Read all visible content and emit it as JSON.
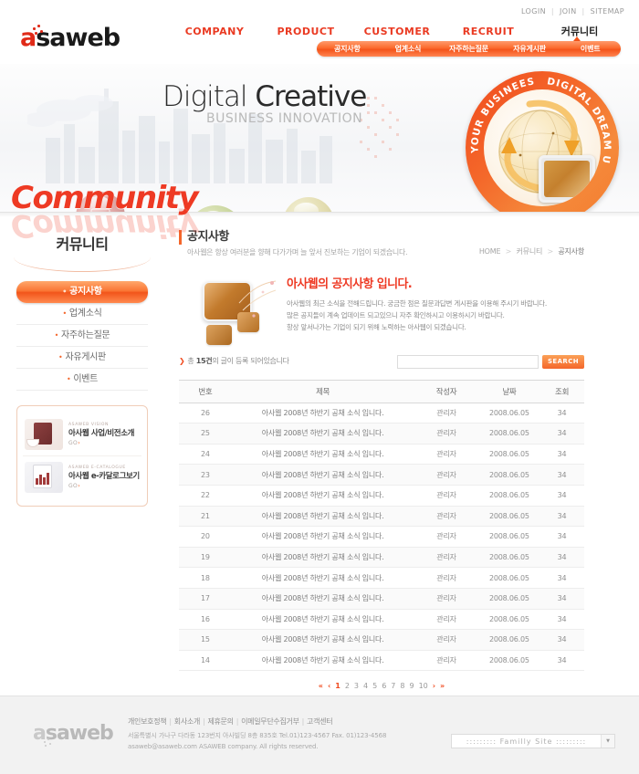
{
  "brand": {
    "logo_a": "a",
    "logo_rest": "saweb",
    "footer_logo_a": "a",
    "footer_logo_rest": "saweb"
  },
  "utility": {
    "login": "LOGIN",
    "join": "JOIN",
    "sitemap": "SITEMAP",
    "sep": "|"
  },
  "mainnav": [
    {
      "label": "COMPANY",
      "kr": false
    },
    {
      "label": "PRODUCT",
      "kr": false
    },
    {
      "label": "CUSTOMER",
      "kr": false
    },
    {
      "label": "RECRUIT",
      "kr": false
    },
    {
      "label": "커뮤니티",
      "kr": true
    }
  ],
  "subnav": [
    {
      "label": "공지사항"
    },
    {
      "label": "업계소식"
    },
    {
      "label": "자주하는질문"
    },
    {
      "label": "자유게시판"
    },
    {
      "label": "이벤트"
    }
  ],
  "hero": {
    "title_1": "Digital",
    "title_2": "Creative",
    "subtitle": "BUSINESS INNOVATION",
    "badge_left": "YOUR BUSINEES PARTNER",
    "badge_right": "DIGITAL DREAM UTOPIA",
    "orb_1_icon": "play-icon",
    "orb_2_icon": "email-icon",
    "orb_3_icon": "click-gear-icon"
  },
  "section": {
    "art_title": "Community",
    "kr_title": "커뮤니티"
  },
  "sidenav": [
    {
      "label": "공지사항",
      "active": true
    },
    {
      "label": "업계소식",
      "active": false
    },
    {
      "label": "자주하는질문",
      "active": false
    },
    {
      "label": "자유게시판",
      "active": false
    },
    {
      "label": "이벤트",
      "active": false
    }
  ],
  "side_banners": [
    {
      "eyebrow": "ASAWEB VISION",
      "title": "아사웹 사업/비전소개",
      "go": "GO"
    },
    {
      "eyebrow": "ASAWEB E-CATALOGUE",
      "title": "아사웹 e-카달로그보기",
      "go": "GO"
    }
  ],
  "page": {
    "title": "공지사항",
    "desc": "아사웹은 항상 여러분을 향해 다가가며 늘 앞서 진보하는 기업이 되겠습니다.",
    "breadcrumb": [
      "HOME",
      "커뮤니티",
      "공지사항"
    ],
    "breadcrumb_sep": ">"
  },
  "intro": {
    "heading": "아사웹의 공지사항 입니다.",
    "lines": [
      "아사웹의 최근 소식을 전해드립니다. 궁금한 점은 질문과답변 게시판을 이용해 주시기 바랍니다.",
      "많은 공지들이 계속 업데이트 되고있으니 자주 확인하시고 이용하시기 바랍니다.",
      "항상 앞서나가는 기업이 되기 위해 노력하는 아사웹이 되겠습니다."
    ]
  },
  "list": {
    "count_prefix": "총",
    "count_value": "15건",
    "count_suffix": "의 글이 등록 되어있습니다",
    "search_placeholder": "",
    "search_value": "",
    "search_button": "SEARCH",
    "columns": [
      "번호",
      "제목",
      "작성자",
      "날짜",
      "조회"
    ],
    "rows": [
      {
        "no": "26",
        "subject": "아사웹 2008년 하반기 공채 소식 입니다.",
        "author": "관리자",
        "date": "2008.06.05",
        "hits": "34"
      },
      {
        "no": "25",
        "subject": "아사웹 2008년 하반기 공채 소식 입니다.",
        "author": "관리자",
        "date": "2008.06.05",
        "hits": "34"
      },
      {
        "no": "24",
        "subject": "아사웹 2008년 하반기 공채 소식 입니다.",
        "author": "관리자",
        "date": "2008.06.05",
        "hits": "34"
      },
      {
        "no": "23",
        "subject": "아사웹 2008년 하반기 공채 소식 입니다.",
        "author": "관리자",
        "date": "2008.06.05",
        "hits": "34"
      },
      {
        "no": "22",
        "subject": "아사웹 2008년 하반기 공채 소식 입니다.",
        "author": "관리자",
        "date": "2008.06.05",
        "hits": "34"
      },
      {
        "no": "21",
        "subject": "아사웹 2008년 하반기 공채 소식 입니다.",
        "author": "관리자",
        "date": "2008.06.05",
        "hits": "34"
      },
      {
        "no": "20",
        "subject": "아사웹 2008년 하반기 공채 소식 입니다.",
        "author": "관리자",
        "date": "2008.06.05",
        "hits": "34"
      },
      {
        "no": "19",
        "subject": "아사웹 2008년 하반기 공채 소식 입니다.",
        "author": "관리자",
        "date": "2008.06.05",
        "hits": "34"
      },
      {
        "no": "18",
        "subject": "아사웹 2008년 하반기 공채 소식 입니다.",
        "author": "관리자",
        "date": "2008.06.05",
        "hits": "34"
      },
      {
        "no": "17",
        "subject": "아사웹 2008년 하반기 공채 소식 입니다.",
        "author": "관리자",
        "date": "2008.06.05",
        "hits": "34"
      },
      {
        "no": "16",
        "subject": "아사웹 2008년 하반기 공채 소식 입니다.",
        "author": "관리자",
        "date": "2008.06.05",
        "hits": "34"
      },
      {
        "no": "15",
        "subject": "아사웹 2008년 하반기 공채 소식 입니다.",
        "author": "관리자",
        "date": "2008.06.05",
        "hits": "34"
      },
      {
        "no": "14",
        "subject": "아사웹 2008년 하반기 공채 소식 입니다.",
        "author": "관리자",
        "date": "2008.06.05",
        "hits": "34"
      }
    ]
  },
  "pager": {
    "first": "«",
    "prev": "‹",
    "next": "›",
    "last": "»",
    "pages": [
      "1",
      "2",
      "3",
      "4",
      "5",
      "6",
      "7",
      "8",
      "9",
      "10"
    ],
    "current": "1"
  },
  "footer": {
    "links": [
      "개인보호정책",
      "회사소개",
      "제휴문의",
      "이메일무단수집거부",
      "고객센터"
    ],
    "sep": "|",
    "address": "서울특별시 가나구 다라동 123번지 아사빌딩 8층 835호 Tel.01)123-4567 Fax. 01)123-4568",
    "copyright": "asaweb@asaweb.com ASAWEB company. All rights reserved.",
    "family_label": "Familly Site",
    "family_deco": ":::::::::"
  },
  "colors": {
    "accent": "#f4662b",
    "accent_dark": "#f04a1e",
    "nav_red": "#ea3a22",
    "text": "#3a3a3a",
    "muted": "#8f8f8f"
  }
}
